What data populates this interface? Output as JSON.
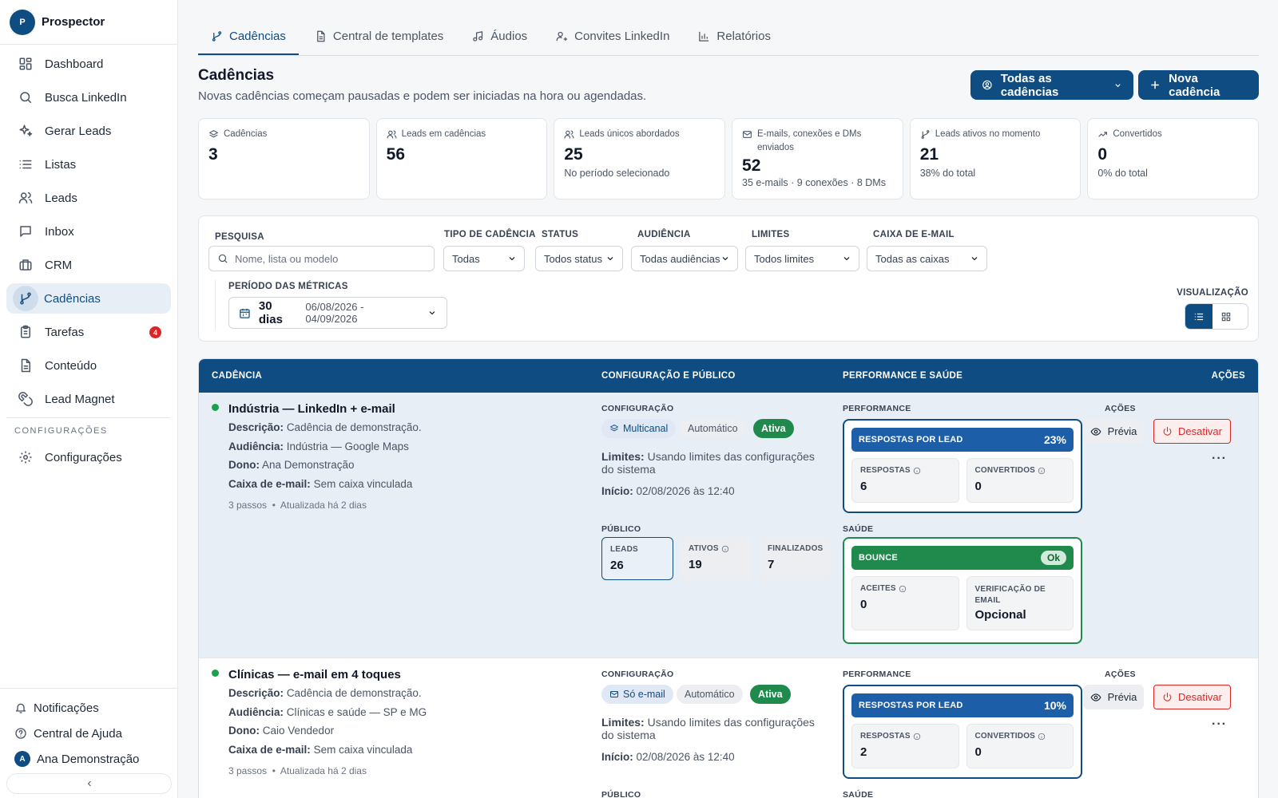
{
  "sidebar": {
    "brand_initial": "P",
    "brand_name": "Prospector",
    "items": [
      {
        "label": "Dashboard",
        "icon": "dashboard-icon"
      },
      {
        "label": "Busca LinkedIn",
        "icon": "search-icon"
      },
      {
        "label": "Gerar Leads",
        "icon": "sparkles-icon"
      },
      {
        "label": "Listas",
        "icon": "list-icon"
      },
      {
        "label": "Leads",
        "icon": "users-icon"
      },
      {
        "label": "Inbox",
        "icon": "message-icon"
      },
      {
        "label": "CRM",
        "icon": "briefcase-icon"
      },
      {
        "label": "Cadências",
        "icon": "branch-icon",
        "active": true
      },
      {
        "label": "Tarefas",
        "icon": "clipboard-icon",
        "badge": "4"
      },
      {
        "label": "Conteúdo",
        "icon": "document-icon"
      },
      {
        "label": "Lead Magnet",
        "icon": "magnet-icon"
      }
    ],
    "section_label": "CONFIGURAÇÕES",
    "settings_label": "Configurações",
    "bottom": {
      "notifications": "Notificações",
      "help": "Central de Ajuda",
      "user_initial": "A",
      "user_name": "Ana Demonstração"
    }
  },
  "tabs": [
    {
      "label": "Cadências",
      "icon": "branch-icon",
      "active": true
    },
    {
      "label": "Central de templates",
      "icon": "document-icon"
    },
    {
      "label": "Áudios",
      "icon": "music-icon"
    },
    {
      "label": "Convites LinkedIn",
      "icon": "user-plus-icon"
    },
    {
      "label": "Relatórios",
      "icon": "bar-chart-icon"
    }
  ],
  "header": {
    "title": "Cadências",
    "subtitle": "Novas cadências começam pausadas e podem ser iniciadas na hora ou agendadas.",
    "filter_button": "Todas as cadências",
    "new_button": "Nova cadência"
  },
  "stats": [
    {
      "label": "Cadências",
      "value": "3",
      "sub": "",
      "icon": "layers-icon"
    },
    {
      "label": "Leads em cadências",
      "value": "56",
      "sub": "",
      "icon": "users-icon"
    },
    {
      "label": "Leads únicos abordados",
      "value": "25",
      "sub": "No período selecionado",
      "icon": "users-icon"
    },
    {
      "label": "E-mails, conexões e DMs enviados",
      "value": "52",
      "sub": "35 e-mails · 9 conexões · 8 DMs",
      "icon": "mail-icon"
    },
    {
      "label": "Leads ativos no momento",
      "value": "21",
      "sub": "38% do total",
      "icon": "branch-icon"
    },
    {
      "label": "Convertidos",
      "value": "0",
      "sub": "0% do total",
      "icon": "trending-up-icon"
    }
  ],
  "filters": {
    "search_label": "PESQUISA",
    "search_placeholder": "Nome, lista ou modelo",
    "tipo_label": "TIPO DE CADÊNCIA",
    "tipo_value": "Todas",
    "status_label": "STATUS",
    "status_value": "Todos status",
    "audiencia_label": "AUDIÊNCIA",
    "audiencia_value": "Todas audiências",
    "limites_label": "LIMITES",
    "limites_value": "Todos limites",
    "caixa_label": "CAIXA DE E-MAIL",
    "caixa_value": "Todas as caixas",
    "period_label": "PERÍODO DAS MÉTRICAS",
    "period_days": "30 dias",
    "period_range": "06/08/2026 - 04/09/2026",
    "viz_label": "VISUALIZAÇÃO"
  },
  "table": {
    "headers": [
      "CADÊNCIA",
      "CONFIGURAÇÃO E PÚBLICO",
      "PERFORMANCE E SAÚDE",
      "AÇÕES"
    ],
    "config_label": "CONFIGURAÇÃO",
    "publico_label": "PÚBLICO",
    "performance_label": "PERFORMANCE",
    "saude_label": "SAÚDE",
    "acoes_label": "AÇÕES",
    "preview_label": "Prévia",
    "deactivate_label": "Desativar",
    "rows": [
      {
        "name": "Indústria — LinkedIn + e-mail",
        "desc_k": "Descrição:",
        "desc_v": "Cadência de demonstração.",
        "aud_k": "Audiência:",
        "aud_v": "Indústria — Google Maps",
        "owner_k": "Dono:",
        "owner_v": "Ana Demonstração",
        "inbox_k": "Caixa de e-mail:",
        "inbox_v": "Sem caixa vinculada",
        "steps": "3 passos",
        "updated": "Atualizada há 2 dias",
        "channel": "Multicanal",
        "mode": "Automático",
        "status": "Ativa",
        "limits_k": "Limites:",
        "limits_v": "Usando limites das configurações do sistema",
        "start_k": "Início:",
        "start_v": "02/08/2026 às 12:40",
        "pub": [
          {
            "label": "LEADS",
            "value": "26"
          },
          {
            "label": "ATIVOS",
            "value": "19"
          },
          {
            "label": "FINALIZADOS",
            "value": "7"
          }
        ],
        "perf_label": "RESPOSTAS POR LEAD",
        "perf_value": "23%",
        "respostas_label": "RESPOSTAS",
        "respostas": "6",
        "convertidos_label": "CONVERTIDOS",
        "convertidos": "0",
        "bounce_label": "BOUNCE",
        "bounce_status": "Ok",
        "aceites_label": "ACEITES",
        "aceites": "0",
        "verif_label": "VERIFICAÇÃO DE EMAIL",
        "verif": "Opcional"
      },
      {
        "name": "Clínicas — e-mail em 4 toques",
        "desc_k": "Descrição:",
        "desc_v": "Cadência de demonstração.",
        "aud_k": "Audiência:",
        "aud_v": "Clínicas e saúde — SP e MG",
        "owner_k": "Dono:",
        "owner_v": "Caio Vendedor",
        "inbox_k": "Caixa de e-mail:",
        "inbox_v": "Sem caixa vinculada",
        "steps": "3 passos",
        "updated": "Atualizada há 2 dias",
        "channel": "Só e-mail",
        "mode": "Automático",
        "status": "Ativa",
        "limits_k": "Limites:",
        "limits_v": "Usando limites das configurações do sistema",
        "start_k": "Início:",
        "start_v": "02/08/2026 às 12:40",
        "perf_label": "RESPOSTAS POR LEAD",
        "perf_value": "10%",
        "respostas_label": "RESPOSTAS",
        "respostas": "2",
        "convertidos_label": "CONVERTIDOS",
        "convertidos": "0"
      }
    ]
  }
}
